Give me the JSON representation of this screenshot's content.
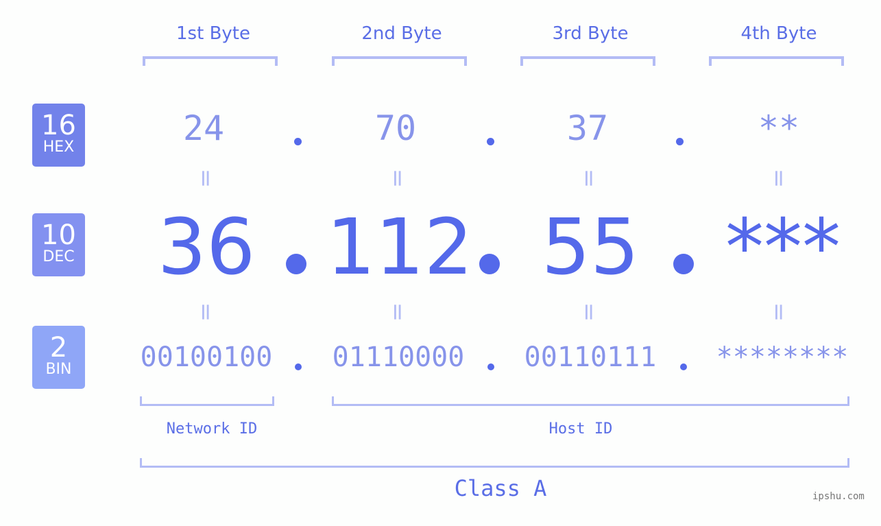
{
  "colors": {
    "hex_badge": "#7282ea",
    "dec_badge": "#8391f0",
    "bin_badge": "#8fa6f7",
    "accent": "#5469ea",
    "bracket": "#b3bcf5"
  },
  "badges": [
    {
      "number": "16",
      "label": "HEX"
    },
    {
      "number": "10",
      "label": "DEC"
    },
    {
      "number": "2",
      "label": "BIN"
    }
  ],
  "byte_headers": [
    "1st Byte",
    "2nd Byte",
    "3rd Byte",
    "4th Byte"
  ],
  "hex": [
    "24",
    "70",
    "37",
    "**"
  ],
  "dec": [
    "36",
    "112",
    "55",
    "***"
  ],
  "bin": [
    "00100100",
    "01110000",
    "00110111",
    "********"
  ],
  "equals": "=",
  "network_label": "Network ID",
  "host_label": "Host ID",
  "class_label": "Class A",
  "watermark": "ipshu.com"
}
